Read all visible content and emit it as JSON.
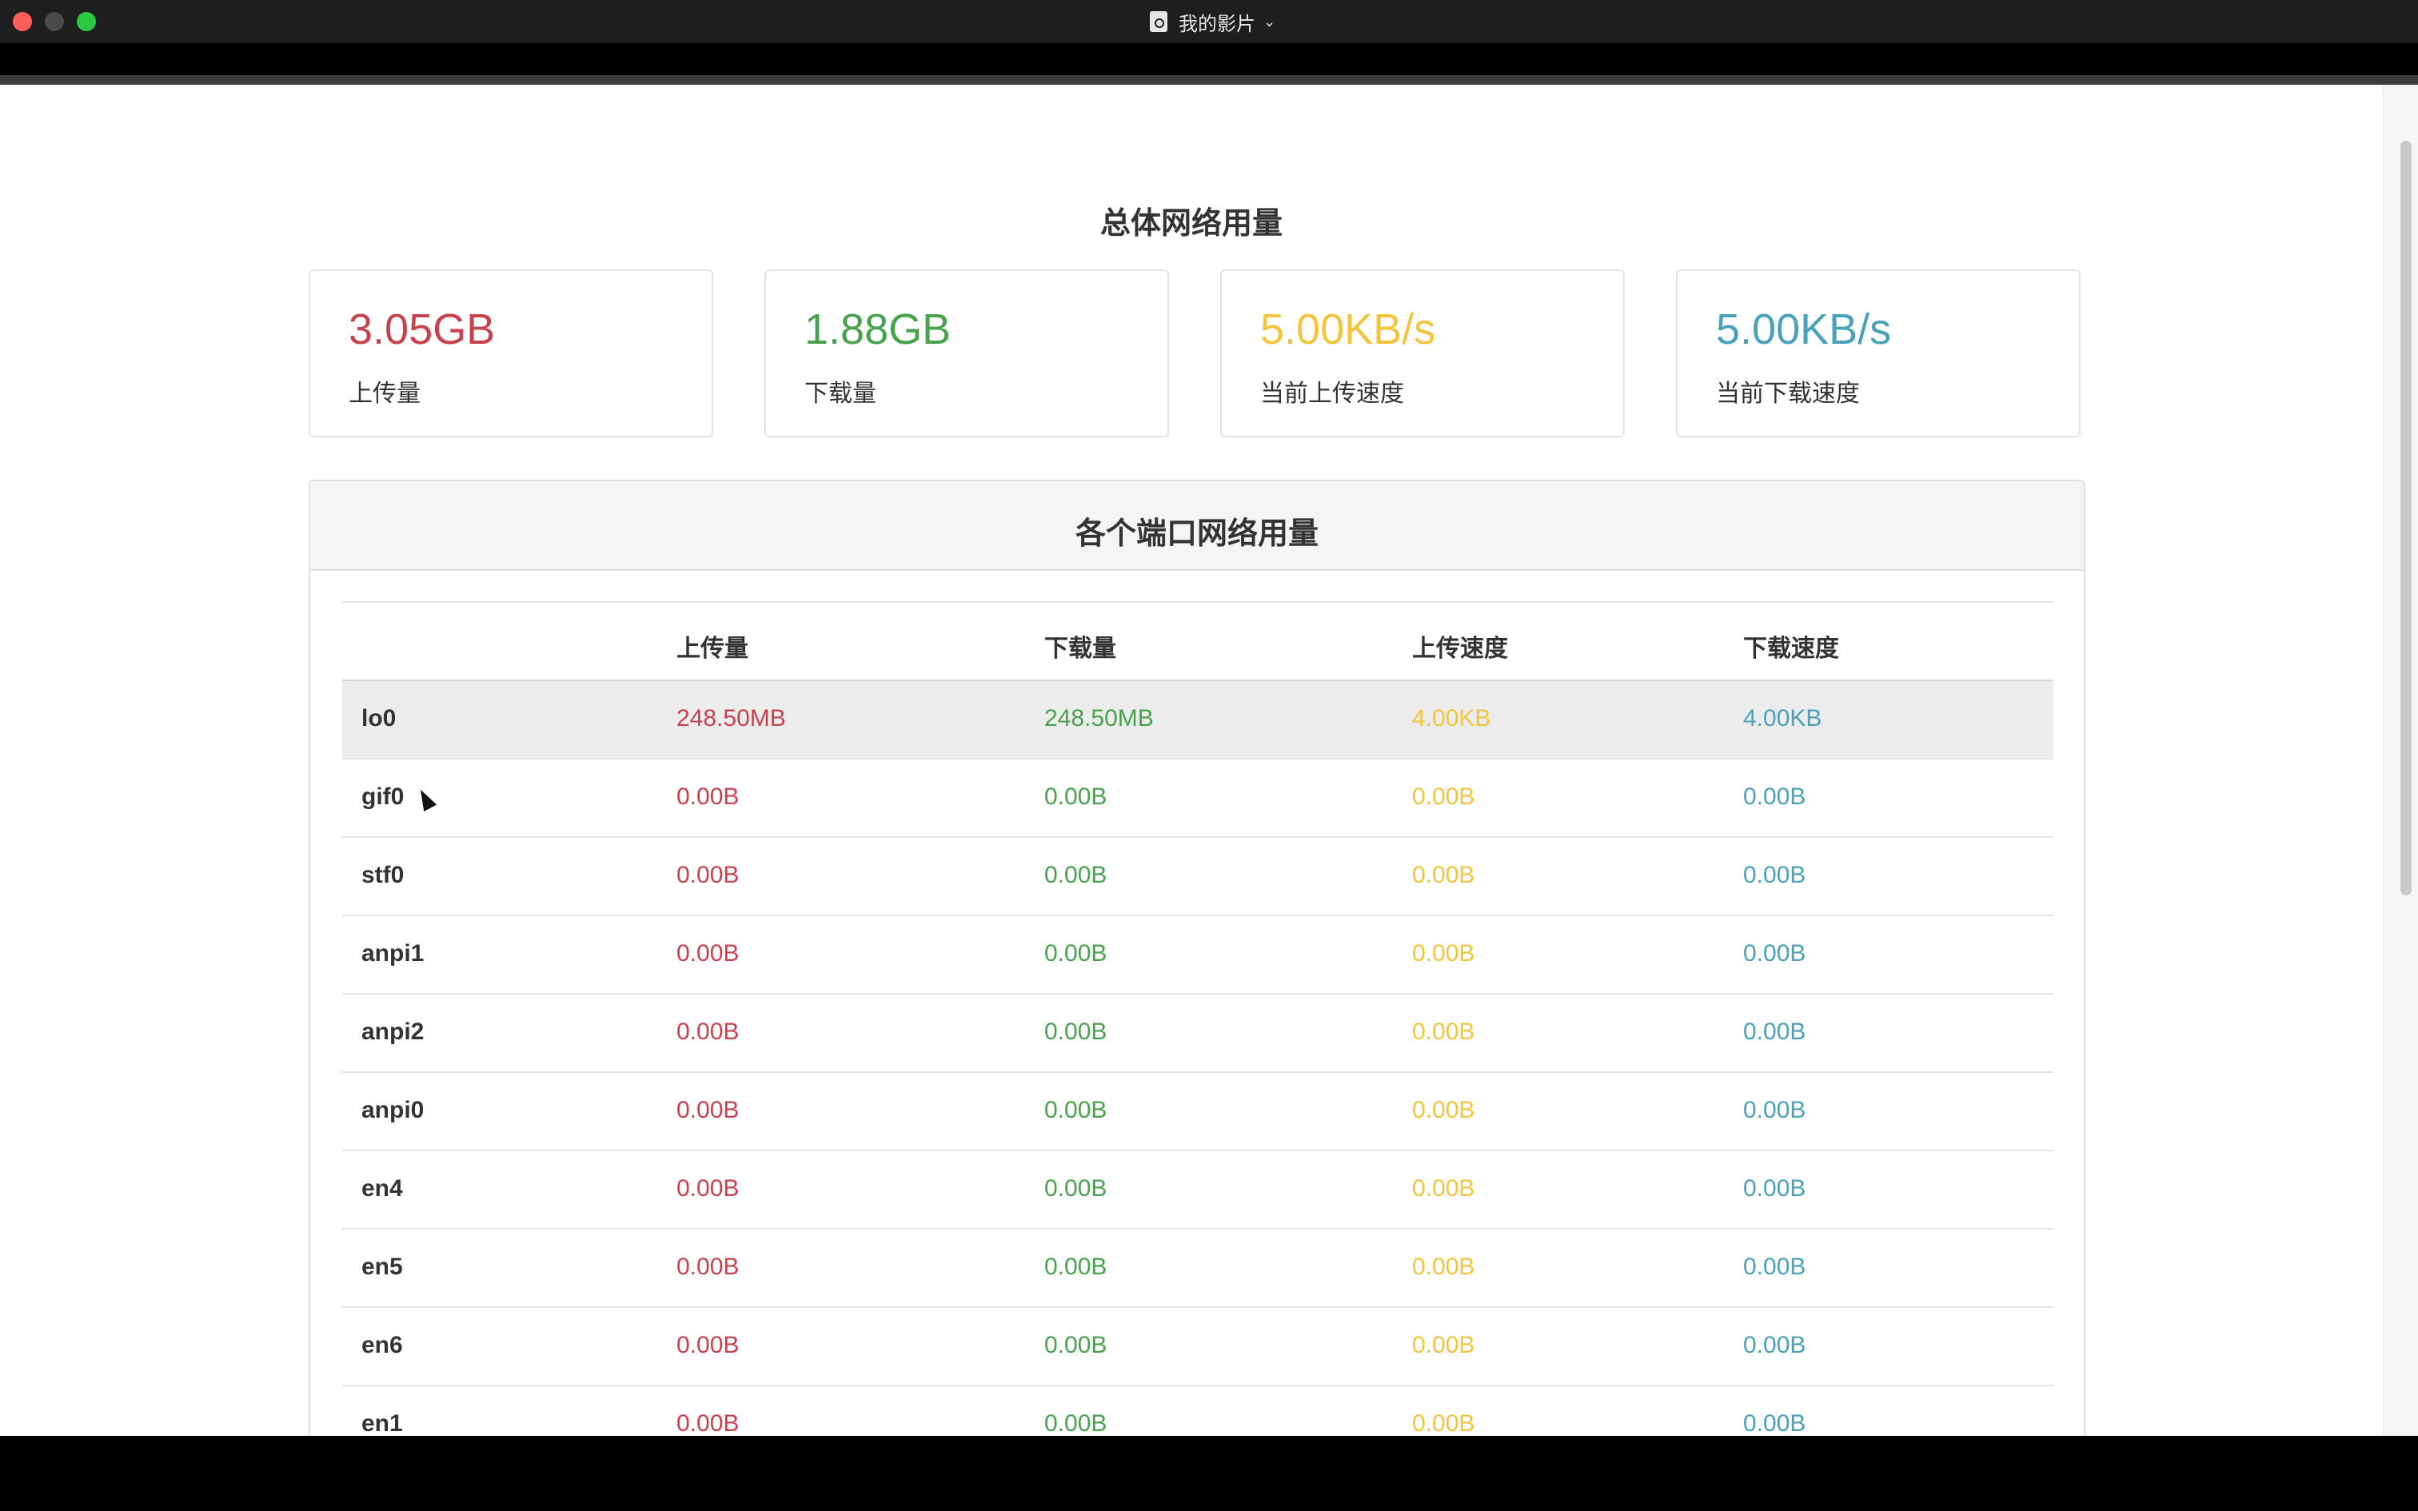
{
  "window": {
    "title": "我的影片",
    "chevron": "⌄",
    "doc_icon": "document-icon"
  },
  "colors": {
    "upload": "#c8414f",
    "download": "#47a34d",
    "upload_speed": "#f2c53d",
    "download_speed": "#4aa2ba"
  },
  "overall": {
    "title": "总体网络用量",
    "cards": [
      {
        "value": "3.05GB",
        "label": "上传量",
        "color": "#c8414f"
      },
      {
        "value": "1.88GB",
        "label": "下载量",
        "color": "#47a34d"
      },
      {
        "value": "5.00KB/s",
        "label": "当前上传速度",
        "color": "#f2c53d"
      },
      {
        "value": "5.00KB/s",
        "label": "当前下载速度",
        "color": "#4aa2ba"
      }
    ]
  },
  "ports": {
    "title": "各个端口网络用量",
    "columns": [
      "",
      "上传量",
      "下载量",
      "上传速度",
      "下载速度"
    ],
    "rows": [
      {
        "name": "lo0",
        "up": "248.50MB",
        "down": "248.50MB",
        "up_speed": "4.00KB",
        "down_speed": "4.00KB"
      },
      {
        "name": "gif0",
        "up": "0.00B",
        "down": "0.00B",
        "up_speed": "0.00B",
        "down_speed": "0.00B"
      },
      {
        "name": "stf0",
        "up": "0.00B",
        "down": "0.00B",
        "up_speed": "0.00B",
        "down_speed": "0.00B"
      },
      {
        "name": "anpi1",
        "up": "0.00B",
        "down": "0.00B",
        "up_speed": "0.00B",
        "down_speed": "0.00B"
      },
      {
        "name": "anpi2",
        "up": "0.00B",
        "down": "0.00B",
        "up_speed": "0.00B",
        "down_speed": "0.00B"
      },
      {
        "name": "anpi0",
        "up": "0.00B",
        "down": "0.00B",
        "up_speed": "0.00B",
        "down_speed": "0.00B"
      },
      {
        "name": "en4",
        "up": "0.00B",
        "down": "0.00B",
        "up_speed": "0.00B",
        "down_speed": "0.00B"
      },
      {
        "name": "en5",
        "up": "0.00B",
        "down": "0.00B",
        "up_speed": "0.00B",
        "down_speed": "0.00B"
      },
      {
        "name": "en6",
        "up": "0.00B",
        "down": "0.00B",
        "up_speed": "0.00B",
        "down_speed": "0.00B"
      },
      {
        "name": "en1",
        "up": "0.00B",
        "down": "0.00B",
        "up_speed": "0.00B",
        "down_speed": "0.00B"
      }
    ]
  }
}
